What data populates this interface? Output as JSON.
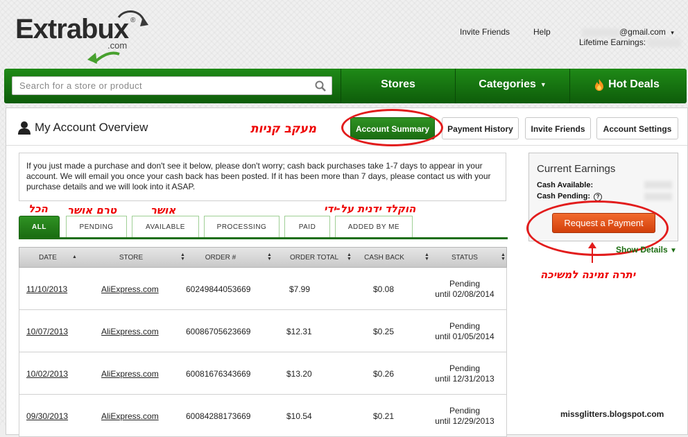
{
  "logo": {
    "name": "Extrabux",
    "suffix": ".com",
    "reg": "®"
  },
  "header": {
    "invite_friends": "Invite Friends",
    "help": "Help",
    "email_domain": "@gmail.com",
    "lifetime_label": "Lifetime Earnings:"
  },
  "nav": {
    "search_placeholder": "Search for a store or product",
    "stores": "Stores",
    "categories": "Categories",
    "hot_deals": "Hot Deals"
  },
  "account": {
    "title": "My Account Overview",
    "tabs": [
      "Account Summary",
      "Payment History",
      "Invite Friends",
      "Account Settings"
    ],
    "active_tab": "Account Summary"
  },
  "annotations": {
    "tracking": "מעקב קניות",
    "all": "הכל",
    "pending": "טרם אושר",
    "approved": "אושר",
    "manual": "הוקלד ידנית על-ידי",
    "balance": "יתרה זמינה למשיכה"
  },
  "notice": "If you just made a purchase and don't see it below, please don't worry; cash back purchases take 1-7 days to appear in your account. We will email you once your cash back has been posted. If it has been more than 7 days, please contact us with your purchase details and we will look into it ASAP.",
  "status_tabs": [
    "ALL",
    "PENDING",
    "AVAILABLE",
    "PROCESSING",
    "PAID",
    "ADDED BY ME"
  ],
  "table": {
    "columns": [
      "DATE",
      "STORE",
      "ORDER #",
      "ORDER TOTAL",
      "CASH BACK",
      "STATUS"
    ],
    "rows": [
      {
        "date": "11/10/2013",
        "store": "AliExpress.com",
        "order": "60249844053669",
        "total": "$7.99",
        "cashback": "$0.08",
        "status": "Pending",
        "until": "until 02/08/2014"
      },
      {
        "date": "10/07/2013",
        "store": "AliExpress.com",
        "order": "60086705623669",
        "total": "$12.31",
        "cashback": "$0.25",
        "status": "Pending",
        "until": "until 01/05/2014"
      },
      {
        "date": "10/02/2013",
        "store": "AliExpress.com",
        "order": "60081676343669",
        "total": "$13.20",
        "cashback": "$0.26",
        "status": "Pending",
        "until": "until 12/31/2013"
      },
      {
        "date": "09/30/2013",
        "store": "AliExpress.com",
        "order": "60084288173669",
        "total": "$10.54",
        "cashback": "$0.21",
        "status": "Pending",
        "until": "until 12/29/2013"
      }
    ]
  },
  "earnings": {
    "title": "Current Earnings",
    "cash_available": "Cash Available:",
    "cash_pending": "Cash Pending:",
    "help": "?",
    "request_payment": "Request a Payment",
    "show_details": "Show Details"
  },
  "credit": "missglitters.blogspot.com",
  "colors": {
    "brand_green": "#1b6d12",
    "accent_orange": "#e2551b",
    "annotation_red": "#e21c1c"
  }
}
